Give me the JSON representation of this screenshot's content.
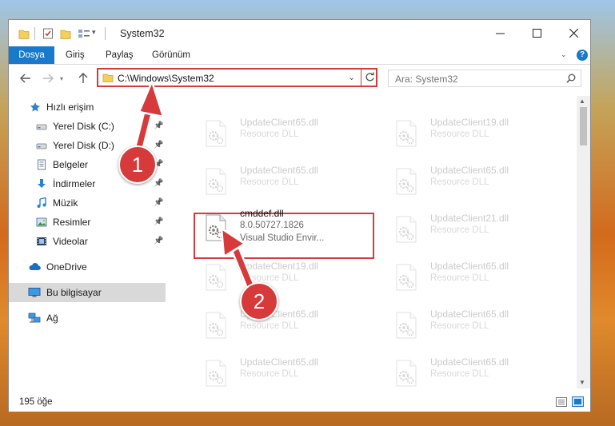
{
  "window": {
    "title": "System32"
  },
  "ribbon": {
    "tabs": [
      "Dosya",
      "Giriş",
      "Paylaş",
      "Görünüm"
    ]
  },
  "address": {
    "path": "C:\\Windows\\System32"
  },
  "search": {
    "placeholder": "Ara: System32"
  },
  "nav": {
    "items": [
      {
        "label": "Hızlı erişim",
        "icon": "star-icon",
        "pinned": false
      },
      {
        "label": "Yerel Disk (C:)",
        "icon": "drive-icon",
        "pinned": true
      },
      {
        "label": "Yerel Disk (D:)",
        "icon": "drive-icon",
        "pinned": true
      },
      {
        "label": "Belgeler",
        "icon": "documents-icon",
        "pinned": true
      },
      {
        "label": "İndirmeler",
        "icon": "downloads-icon",
        "pinned": true
      },
      {
        "label": "Müzik",
        "icon": "music-icon",
        "pinned": true
      },
      {
        "label": "Resimler",
        "icon": "pictures-icon",
        "pinned": true
      },
      {
        "label": "Videolar",
        "icon": "videos-icon",
        "pinned": true
      },
      {
        "label": "OneDrive",
        "icon": "cloud-icon",
        "pinned": false
      },
      {
        "label": "Bu bilgisayar",
        "icon": "computer-icon",
        "pinned": false
      },
      {
        "label": "Ağ",
        "icon": "network-icon",
        "pinned": false
      }
    ]
  },
  "files": [
    {
      "name": "UpdateClient65.dll",
      "desc": "Resource DLL"
    },
    {
      "name": "UpdateClient19.dll",
      "desc": "Resource DLL"
    },
    {
      "name": "UpdateClient65.dll",
      "desc": "Resource DLL"
    },
    {
      "name": "UpdateClient65.dll",
      "desc": "Resource DLL"
    },
    {
      "name": "cmddef.dll",
      "version": "8.0.50727.1826",
      "desc": "Visual Studio Envir...",
      "highlighted": true
    },
    {
      "name": "UpdateClient21.dll",
      "desc": "Resource DLL"
    },
    {
      "name": "UpdateClient19.dll",
      "desc": "Resource DLL"
    },
    {
      "name": "UpdateClient65.dll",
      "desc": "Resource DLL"
    },
    {
      "name": "UpdateClient65.dll",
      "desc": "Resource DLL"
    },
    {
      "name": "UpdateClient65.dll",
      "desc": "Resource DLL"
    },
    {
      "name": "UpdateClient65.dll",
      "desc": "Resource DLL"
    },
    {
      "name": "UpdateClient65.dll",
      "desc": "Resource DLL"
    }
  ],
  "status": {
    "count": "195 öğe"
  },
  "annotations": {
    "badge1": "1",
    "badge2": "2"
  },
  "colors": {
    "accent": "#1979ca",
    "highlight": "#d63a3a"
  }
}
